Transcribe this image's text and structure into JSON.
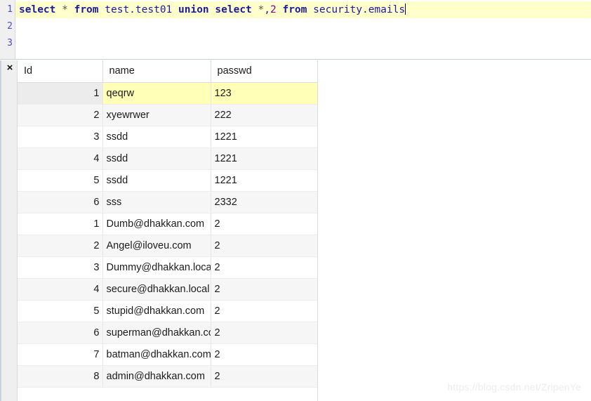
{
  "editor": {
    "line_numbers": [
      "1",
      "2",
      "3"
    ],
    "active_line": 1,
    "sql_plain": "select * from test.test01 union select *,2 from security.emails",
    "tokens": [
      {
        "text": "select",
        "type": "keyword"
      },
      {
        "text": " ",
        "type": "space"
      },
      {
        "text": "*",
        "type": "star"
      },
      {
        "text": " ",
        "type": "space"
      },
      {
        "text": "from",
        "type": "keyword"
      },
      {
        "text": " ",
        "type": "space"
      },
      {
        "text": "test.test01",
        "type": "ident"
      },
      {
        "text": " ",
        "type": "space"
      },
      {
        "text": "union",
        "type": "keyword"
      },
      {
        "text": " ",
        "type": "space"
      },
      {
        "text": "select",
        "type": "keyword"
      },
      {
        "text": " ",
        "type": "space"
      },
      {
        "text": "*",
        "type": "star"
      },
      {
        "text": ",",
        "type": "punct"
      },
      {
        "text": "2",
        "type": "num"
      },
      {
        "text": " ",
        "type": "space"
      },
      {
        "text": "from",
        "type": "keyword"
      },
      {
        "text": " ",
        "type": "space"
      },
      {
        "text": "security.emails",
        "type": "ident"
      }
    ],
    "line2_text": "",
    "line3_text": ""
  },
  "results": {
    "close_label": "×",
    "columns": [
      "Id",
      "name",
      "passwd"
    ],
    "selected_row_index": 0,
    "rows": [
      {
        "Id": "1",
        "name": "qeqrw",
        "passwd": "123"
      },
      {
        "Id": "2",
        "name": "xyewrwer",
        "passwd": "222"
      },
      {
        "Id": "3",
        "name": "ssdd",
        "passwd": "1221"
      },
      {
        "Id": "4",
        "name": "ssdd",
        "passwd": "1221"
      },
      {
        "Id": "5",
        "name": "ssdd",
        "passwd": "1221"
      },
      {
        "Id": "6",
        "name": "sss",
        "passwd": "2332"
      },
      {
        "Id": "1",
        "name": "Dumb@dhakkan.com",
        "passwd": "2"
      },
      {
        "Id": "2",
        "name": "Angel@iloveu.com",
        "passwd": "2"
      },
      {
        "Id": "3",
        "name": "Dummy@dhakkan.local",
        "passwd": "2"
      },
      {
        "Id": "4",
        "name": "secure@dhakkan.local",
        "passwd": "2"
      },
      {
        "Id": "5",
        "name": "stupid@dhakkan.com",
        "passwd": "2"
      },
      {
        "Id": "6",
        "name": "superman@dhakkan.com",
        "passwd": "2"
      },
      {
        "Id": "7",
        "name": "batman@dhakkan.com",
        "passwd": "2"
      },
      {
        "Id": "8",
        "name": "admin@dhakkan.com",
        "passwd": "2"
      }
    ]
  },
  "watermark": {
    "text": "https://blog.csdn.net/ZripenYe"
  },
  "colors": {
    "keyword": "#1a1a9e",
    "number_literal": "#8b008b",
    "active_line_bg": "#ffffcc",
    "selected_cell_bg": "#ffffb8",
    "gutter_bg": "#efefef",
    "alt_row_bg": "#f6f6f6"
  }
}
